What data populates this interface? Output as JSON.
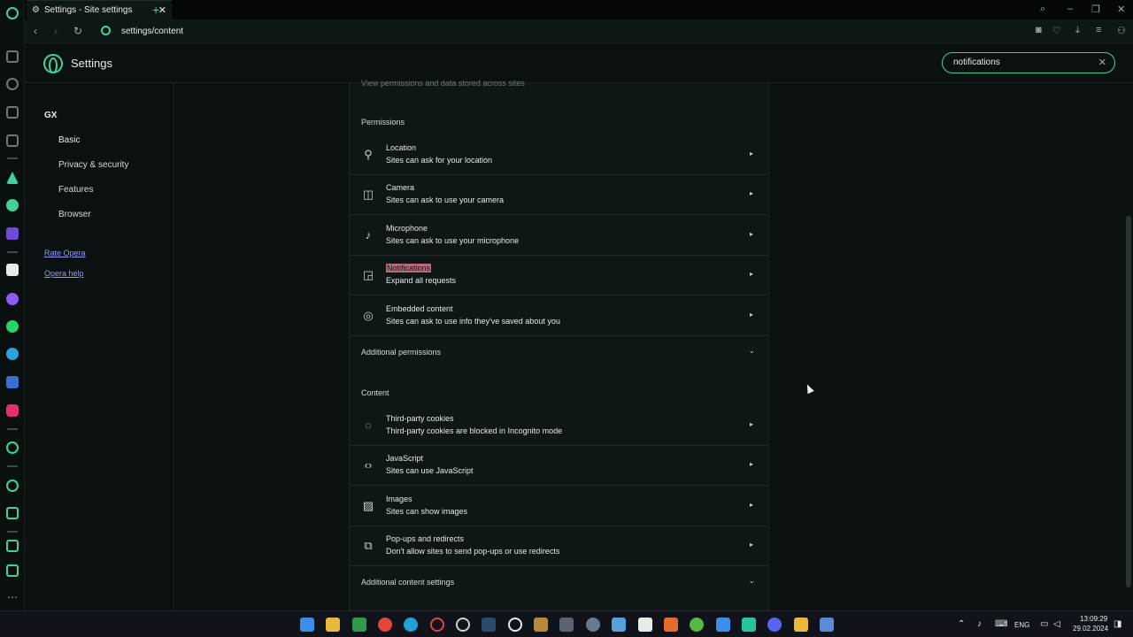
{
  "browser": {
    "tab_title": "Settings - Site settings",
    "url": "settings/content"
  },
  "settings": {
    "title": "Settings",
    "search_value": "notifications"
  },
  "nav": {
    "gx": "GX",
    "items": [
      "Basic",
      "Privacy & security",
      "Features",
      "Browser"
    ],
    "links": [
      "Rate Opera",
      "Opera help"
    ]
  },
  "panel": {
    "top_text": "View permissions and data stored across sites",
    "permissions_title": "Permissions",
    "permissions": [
      {
        "icon": "location-pin-icon",
        "title": "Location",
        "desc": "Sites can ask for your location"
      },
      {
        "icon": "camera-icon",
        "title": "Camera",
        "desc": "Sites can ask to use your camera"
      },
      {
        "icon": "microphone-icon",
        "title": "Microphone",
        "desc": "Sites can ask to use your microphone"
      },
      {
        "icon": "notification-icon",
        "title": "Notifications",
        "desc": "Expand all requests"
      },
      {
        "icon": "embedded-content-icon",
        "title": "Embedded content",
        "desc": "Sites can ask to use info they've saved about you"
      }
    ],
    "additional_permissions": "Additional permissions",
    "content_title": "Content",
    "content": [
      {
        "icon": "cookie-icon",
        "title": "Third-party cookies",
        "desc": "Third-party cookies are blocked in Incognito mode"
      },
      {
        "icon": "code-icon",
        "title": "JavaScript",
        "desc": "Sites can use JavaScript"
      },
      {
        "icon": "image-icon",
        "title": "Images",
        "desc": "Sites can show images"
      },
      {
        "icon": "popup-icon",
        "title": "Pop-ups and redirects",
        "desc": "Don't allow sites to send pop-ups or use redirects"
      }
    ],
    "additional_content": "Additional content settings"
  },
  "taskbar": {
    "lang": "ENG",
    "time": "13:09:29",
    "date": "29.02.2024"
  },
  "colors": {
    "accent": "#3fd39a",
    "highlight": "#b76b7c",
    "link": "#8e9cf7"
  }
}
